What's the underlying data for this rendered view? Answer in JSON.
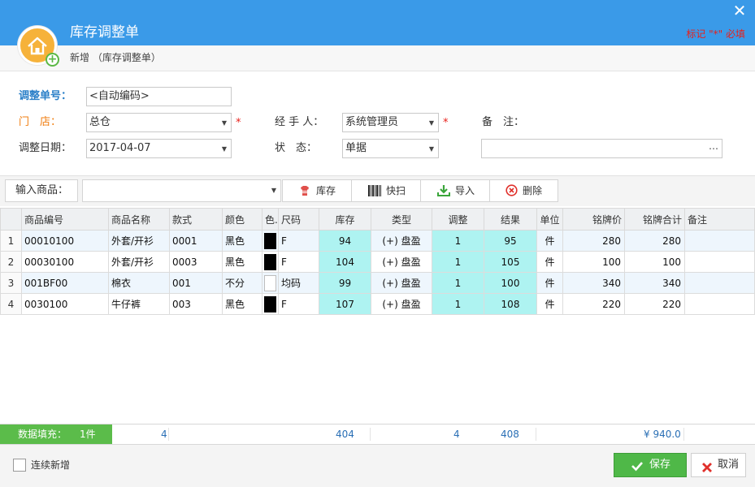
{
  "window": {
    "title": "库存调整单",
    "breadcrumb": "新增 （库存调整单）",
    "required_note": "标记 \"*\" 必填",
    "close_glyph": "✕"
  },
  "form": {
    "order_no": {
      "label": "调整单号：",
      "value": "<自动编码>"
    },
    "store": {
      "label": "门　店：",
      "value": "总仓"
    },
    "handler": {
      "label": "经 手 人：",
      "value": "系统管理员"
    },
    "remark": {
      "label": "备　注：",
      "value": ""
    },
    "date": {
      "label": "调整日期：",
      "value": "2017-04-07"
    },
    "status": {
      "label": "状　态：",
      "value": "单据"
    },
    "required_mark": "*"
  },
  "toolbar": {
    "product_label": "输入商品：",
    "product_value": "",
    "stock_label": "库存",
    "scan_label": "快扫",
    "import_label": "导入",
    "delete_label": "删除"
  },
  "table": {
    "columns": [
      "",
      "商品编号",
      "商品名称",
      "款式",
      "颜色",
      "色.",
      "尺码",
      "库存",
      "类型",
      "调整",
      "结果",
      "单位",
      "铭牌价",
      "铭牌合计",
      "备注"
    ],
    "rows": [
      {
        "num": "1",
        "code": "00010100",
        "name": "外套/开衫",
        "style": "0001",
        "color": "黑色",
        "swatch": "#000000",
        "size": "F",
        "stock": "94",
        "type": "(+) 盘盈",
        "adjust": "1",
        "result": "95",
        "unit": "件",
        "price": "280",
        "total": "280",
        "note": ""
      },
      {
        "num": "2",
        "code": "00030100",
        "name": "外套/开衫",
        "style": "0003",
        "color": "黑色",
        "swatch": "#000000",
        "size": "F",
        "stock": "104",
        "type": "(+) 盘盈",
        "adjust": "1",
        "result": "105",
        "unit": "件",
        "price": "100",
        "total": "100",
        "note": ""
      },
      {
        "num": "3",
        "code": "001BF00",
        "name": "棉衣",
        "style": "001",
        "color": "不分",
        "swatch": "#ffffff",
        "size": "均码",
        "stock": "99",
        "type": "(+) 盘盈",
        "adjust": "1",
        "result": "100",
        "unit": "件",
        "price": "340",
        "total": "340",
        "note": ""
      },
      {
        "num": "4",
        "code": "0030100",
        "name": "牛仔裤",
        "style": "003",
        "color": "黑色",
        "swatch": "#000000",
        "size": "F",
        "stock": "107",
        "type": "(+) 盘盈",
        "adjust": "1",
        "result": "108",
        "unit": "件",
        "price": "220",
        "total": "220",
        "note": ""
      }
    ]
  },
  "summary": {
    "fill_label": "数据填充：",
    "fill_count": "1件",
    "count": "4",
    "stock_total": "404",
    "adjust_total": "4",
    "result_total": "408",
    "amount_total": "¥ 940.0"
  },
  "footer": {
    "continue_label": "连续新增",
    "save_label": "保存",
    "cancel_label": "取消"
  },
  "colors": {
    "header": "#3a9ae8",
    "accent_cyan": "#aef3f1",
    "save_green": "#4fb848",
    "required_red": "#e8201b",
    "label_blue": "#2a7fc8",
    "label_orange": "#f07e10"
  }
}
